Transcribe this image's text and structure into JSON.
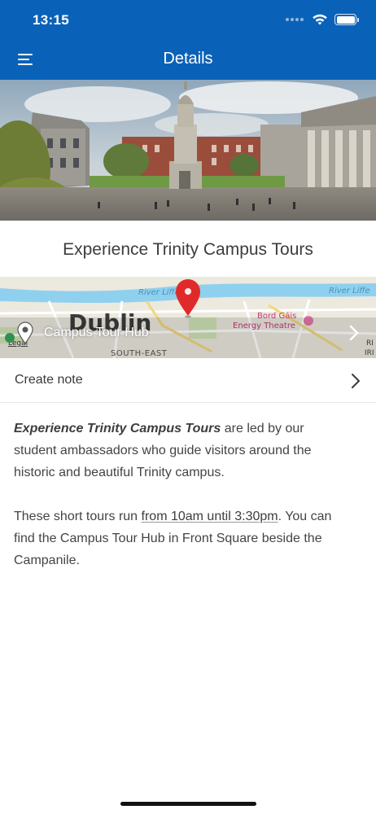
{
  "status_bar": {
    "time": "13:15"
  },
  "header": {
    "title": "Details"
  },
  "hero": {
    "image": "trinity-campus-photo"
  },
  "page": {
    "title": "Experience Trinity Campus Tours"
  },
  "map": {
    "location_label": "Campus Tour Hub",
    "labels": {
      "river_left": "River Liffey",
      "river_right": "River Liffe",
      "city": "Dublin",
      "district": "SOUTH-EAST",
      "theatre_line1": "Bord Gáis",
      "theatre_line2": "Energy Theatre",
      "legal": "Legal",
      "edge_top": "RI",
      "edge_bottom": "IRI"
    }
  },
  "note_row": {
    "label": "Create note"
  },
  "content": {
    "p1_emphasis": "Experience Trinity Campus Tours",
    "p1_line1_rest": " are led by our",
    "p1_line2": "student ambassadors who guide visitors around the",
    "p1_line3": "historic and beautiful Trinity campus.",
    "p2_prefix": "These short tours run ",
    "p2_link": "from 10am until 3:30pm",
    "p2_line1_rest": ". You can",
    "p2_line2": "find the Campus Tour Hub in Front Square beside the",
    "p2_line3": "Campanile."
  },
  "colors": {
    "header_bg": "#0a62b8",
    "pin_red": "#e02a2a"
  }
}
